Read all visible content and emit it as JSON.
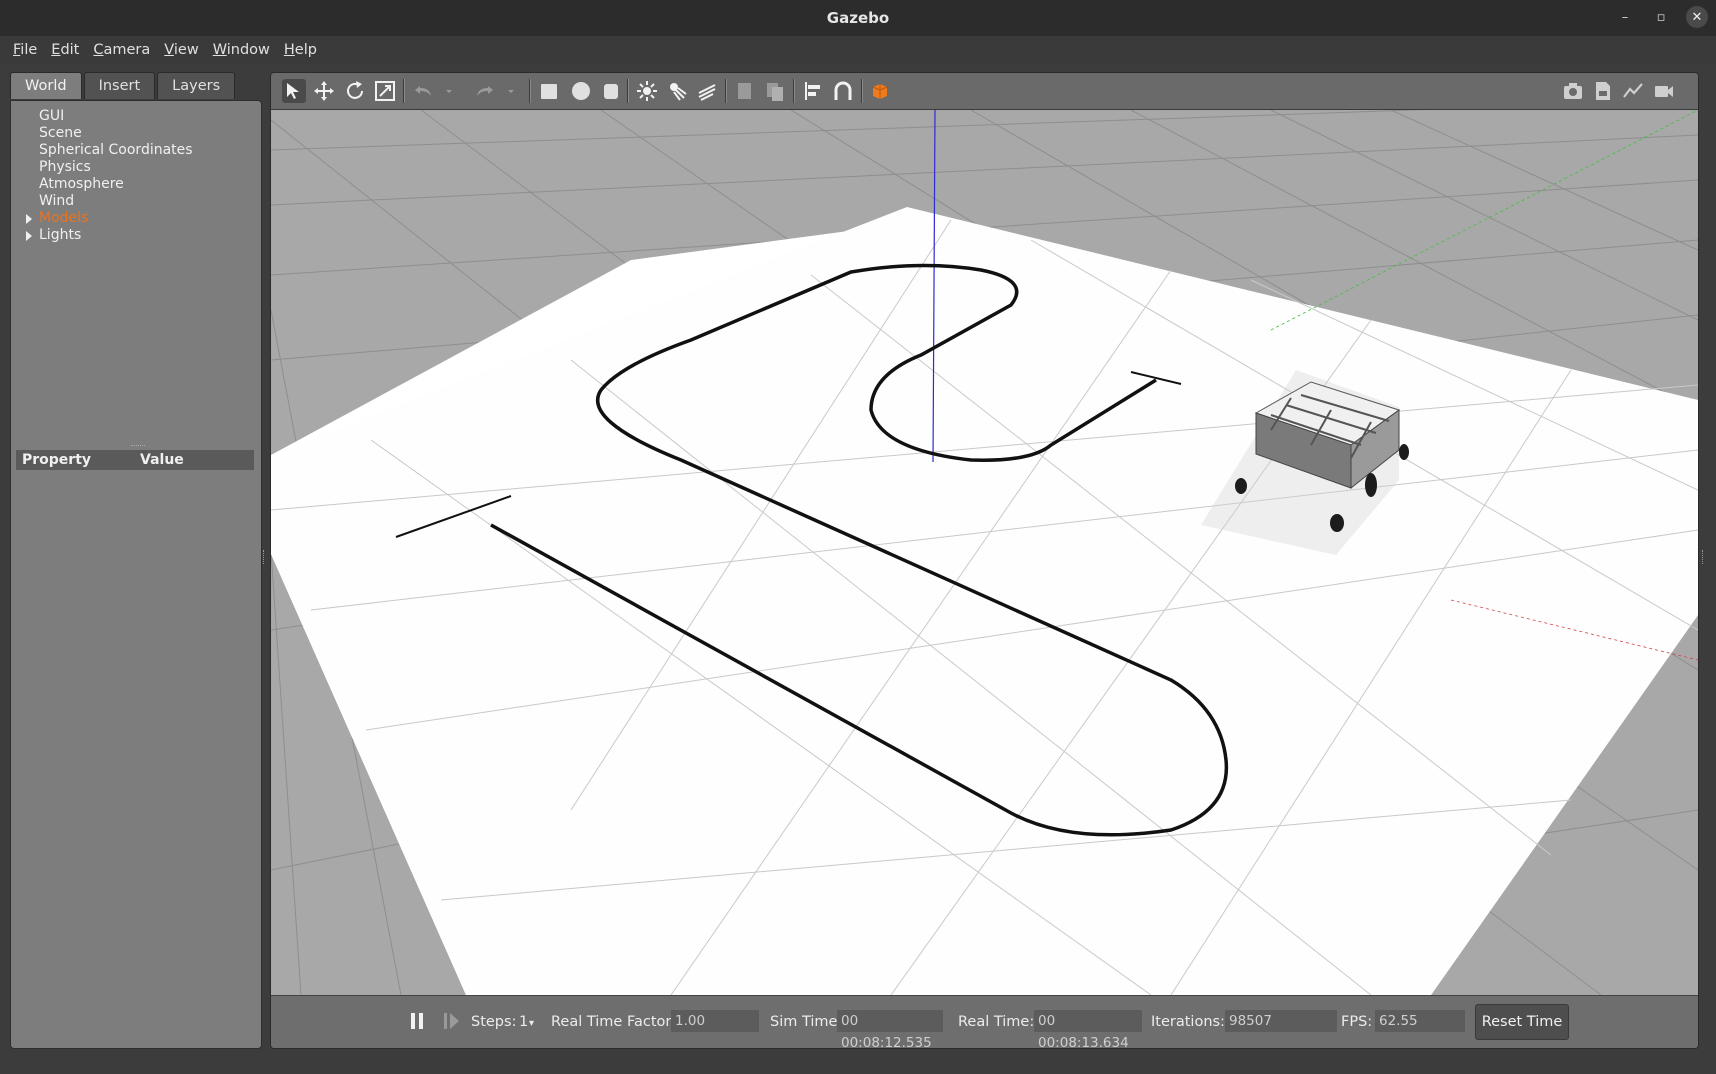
{
  "window": {
    "title": "Gazebo",
    "controls": [
      "minimize",
      "maximize",
      "close"
    ]
  },
  "menubar": [
    {
      "label": "File",
      "mnemonic": "F",
      "rest": "ile"
    },
    {
      "label": "Edit",
      "mnemonic": "E",
      "rest": "dit"
    },
    {
      "label": "Camera",
      "mnemonic": "C",
      "rest": "amera"
    },
    {
      "label": "View",
      "mnemonic": "V",
      "rest": "iew"
    },
    {
      "label": "Window",
      "mnemonic": "W",
      "rest": "indow"
    },
    {
      "label": "Help",
      "mnemonic": "H",
      "rest": "elp"
    }
  ],
  "left_panel": {
    "tabs": [
      "World",
      "Insert",
      "Layers"
    ],
    "active_tab": "World",
    "tree": [
      {
        "label": "GUI",
        "expandable": false
      },
      {
        "label": "Scene",
        "expandable": false
      },
      {
        "label": "Spherical Coordinates",
        "expandable": false
      },
      {
        "label": "Physics",
        "expandable": false
      },
      {
        "label": "Atmosphere",
        "expandable": false
      },
      {
        "label": "Wind",
        "expandable": false
      },
      {
        "label": "Models",
        "expandable": true,
        "highlighted": true
      },
      {
        "label": "Lights",
        "expandable": true
      }
    ],
    "property_header": {
      "property": "Property",
      "value": "Value"
    }
  },
  "toolbar": {
    "left_tools": [
      "select-mode-icon",
      "translate-mode-icon",
      "rotate-mode-icon",
      "scale-mode-icon",
      "undo-icon",
      "undo-history-icon",
      "redo-icon",
      "redo-history-icon",
      "box-shape-icon",
      "sphere-shape-icon",
      "cylinder-shape-icon",
      "point-light-icon",
      "spot-light-icon",
      "directional-light-icon",
      "copy-icon",
      "paste-icon",
      "align-icon",
      "snap-icon",
      "change-view-icon"
    ],
    "right_tools": [
      "screenshot-icon",
      "log-icon",
      "plot-icon",
      "record-video-icon"
    ]
  },
  "bottom_bar": {
    "steps_label": "Steps:",
    "steps_value": "1",
    "rtf_label": "Real Time Factor:",
    "rtf_value": "1.00",
    "sim_time_label": "Sim Time:",
    "sim_time_value": "00 00:08:12.535",
    "real_time_label": "Real Time:",
    "real_time_value": "00 00:08:13.634",
    "iterations_label": "Iterations:",
    "iterations_value": "98507",
    "fps_label": "FPS:",
    "fps_value": "62.55",
    "reset_label": "Reset Time"
  },
  "colors": {
    "highlight": "#e8741e",
    "z_axis": "#2b2bd6",
    "y_axis": "#3fbf3f",
    "x_axis": "#d24444"
  }
}
